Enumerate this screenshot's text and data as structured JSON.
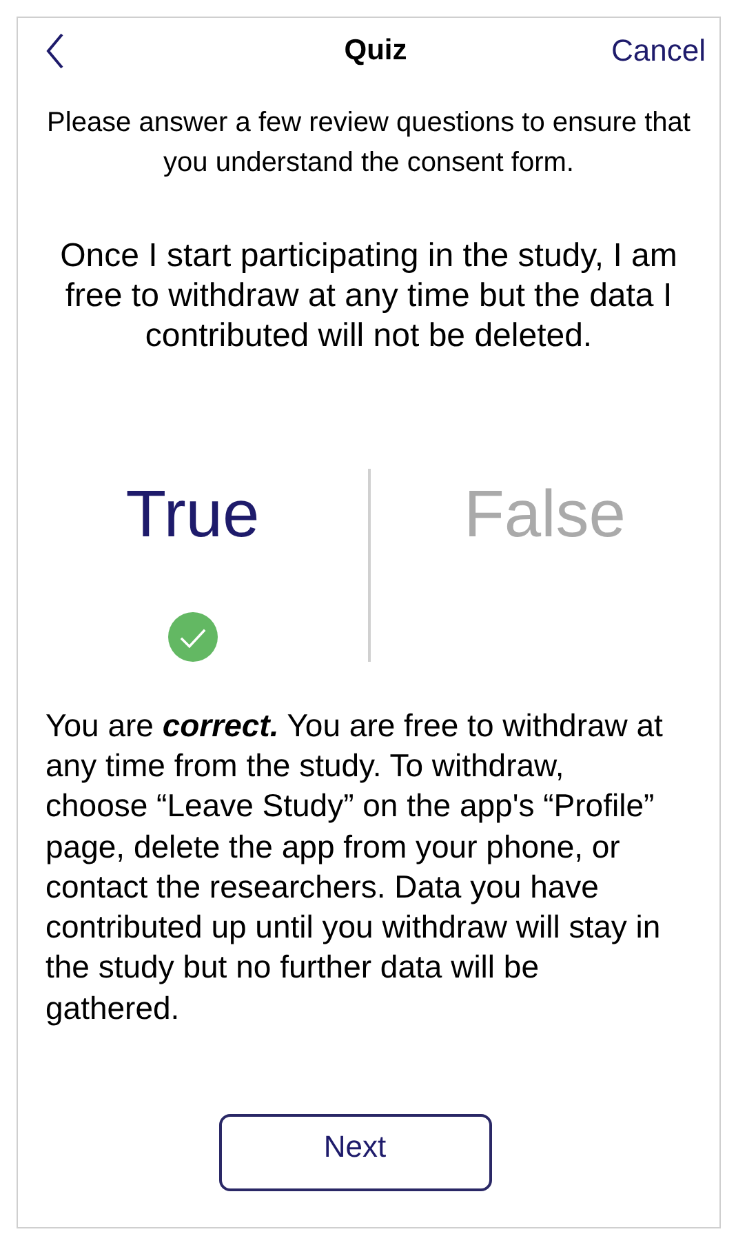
{
  "nav": {
    "title": "Quiz",
    "cancel": "Cancel"
  },
  "intro": "Please answer a few review questions to ensure that you understand the consent form.",
  "question": "Once I start participating in the study, I am free to withdraw at any time but the data I contributed will not be deleted.",
  "options": [
    {
      "label": "True",
      "selected": true
    },
    {
      "label": "False",
      "selected": false
    }
  ],
  "feedback": "You are **correct.** You are free to withdraw at any time from the study. To withdraw, choose “Leave Study” on the app's “Profile” page, delete the app from your phone, or contact the researchers. Data you have contributed up until you withdraw will stay in the study but no further data will be gathered.",
  "next_button": "Next"
}
